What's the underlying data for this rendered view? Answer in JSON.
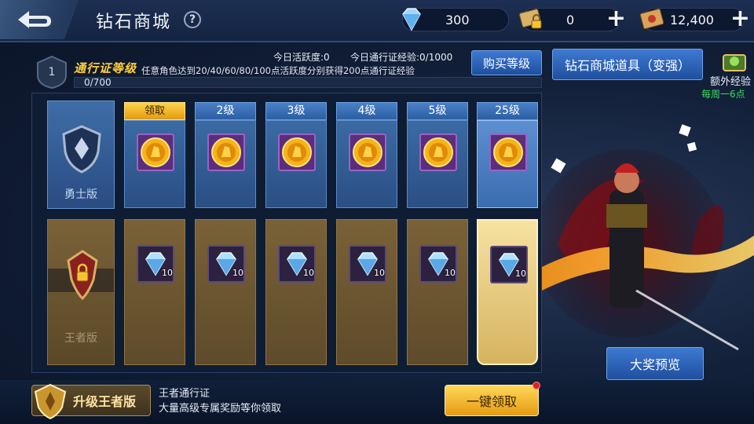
{
  "header": {
    "title": "钻石商城",
    "help_label": "?",
    "diamonds": "300",
    "tickets": "0",
    "vouchers": "12,400",
    "plus_label": "+"
  },
  "pass": {
    "level": "1",
    "title": "通行证等级",
    "description": "任意角色达到20/40/60/80/100点活跃度分别获得200点通行证经验",
    "xp_text": "0/700",
    "xp_progress": 0,
    "today_activity": "今日活跃度:0",
    "today_xp": "今日通行证经验:0/1000",
    "buy_level_label": "购买等级",
    "shop_items_label": "钻石商城道具（变强）"
  },
  "tiers": {
    "warrior_label": "勇士版",
    "king_label": "王者版",
    "columns": [
      {
        "tag": "领取",
        "claimable": true,
        "gem_qty": "10"
      },
      {
        "tag": "2级",
        "claimable": false,
        "gem_qty": "10"
      },
      {
        "tag": "3级",
        "claimable": false,
        "gem_qty": "10"
      },
      {
        "tag": "4级",
        "claimable": false,
        "gem_qty": "10"
      },
      {
        "tag": "5级",
        "claimable": false,
        "gem_qty": "10"
      },
      {
        "tag": "25级",
        "claimable": false,
        "gem_qty": "10",
        "highlight": true
      }
    ]
  },
  "side": {
    "extra_exp": "额外经验",
    "weekly_limit": "每周一6点",
    "grand_prize_label": "大奖预览"
  },
  "footer": {
    "upgrade_label": "升级王者版",
    "king_pass_line1": "王者通行证",
    "king_pass_line2": "大量高级专属奖励等你领取",
    "claim_all_label": "一键领取"
  },
  "colors": {
    "accent_gold": "#ffcf3a",
    "accent_blue": "#3e7ad2",
    "weekly_green": "#3ddc5a"
  }
}
